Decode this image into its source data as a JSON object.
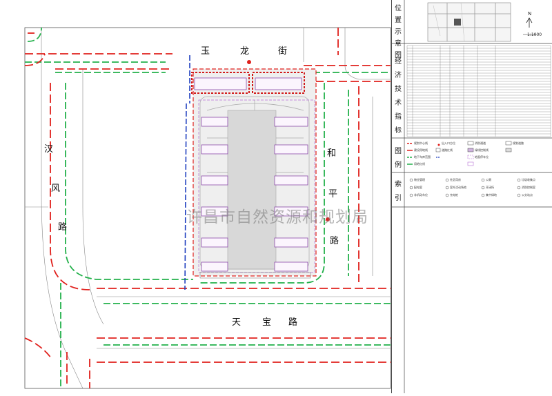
{
  "roads": {
    "north": [
      "玉",
      "龙",
      "街"
    ],
    "west": [
      "汉",
      "风",
      "路"
    ],
    "east": [
      "和",
      "平",
      "路"
    ],
    "south": [
      "天",
      "宝",
      "路"
    ]
  },
  "watermark": "许昌市自然资源和规划局",
  "side_titles": {
    "location": [
      "位",
      "置",
      "示",
      "意",
      "图"
    ],
    "indicators": [
      "经",
      "济",
      "技",
      "术",
      "指",
      "标"
    ],
    "legend": [
      "图",
      "例"
    ],
    "index": [
      "索",
      "引"
    ]
  },
  "location_map": {
    "north_mark": "N",
    "scale": "1:1000"
  },
  "legend_items": [
    "规划中心线",
    "出入口方位",
    "消防通道",
    "规划道路",
    "建设用地线",
    "道路红线",
    "绿线控制线",
    "地下车库范围",
    "地面停车位",
    "用地红线"
  ],
  "index_items": [
    "物业管理",
    "社区用房",
    "公厕",
    "垃圾收集点",
    "配电室",
    "室外活动场地",
    "开闭所",
    "消防控制室",
    "非机动车位",
    "充电桩",
    "集中绿地",
    "公交站点"
  ],
  "colors": {
    "road_red": "#e0201c",
    "green_line": "#22b04a",
    "blue_line": "#1f3fbf",
    "building": "#8a4aa8",
    "site_fill": "#efefef"
  }
}
